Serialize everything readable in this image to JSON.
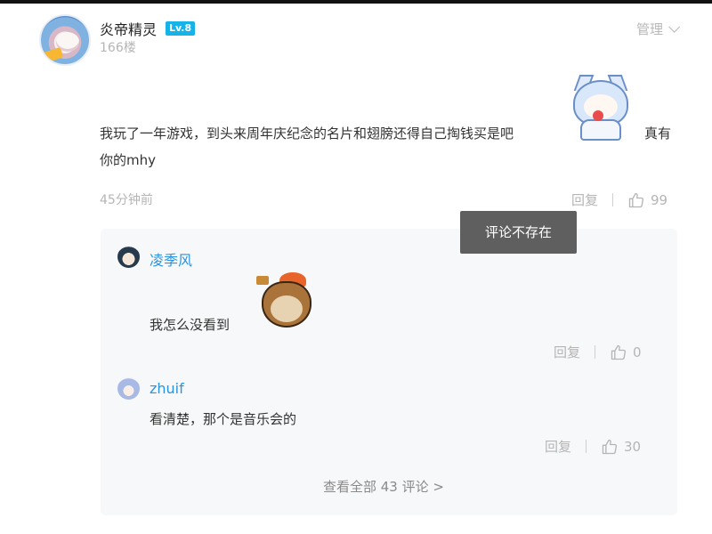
{
  "post": {
    "username": "炎帝精灵",
    "level": "Lv.8",
    "floor": "166楼",
    "manage_label": "管理",
    "content_line1": "我玩了一年游戏，到头来周年庆纪念的名片和翅膀还得自己掏钱买是吧",
    "content_tail": "真有",
    "content_line2": "你的mhy",
    "time": "45分钟前",
    "reply_label": "回复",
    "like_count": "99"
  },
  "replies": [
    {
      "name": "凌季风",
      "text": "我怎么没看到",
      "reply_label": "回复",
      "like_count": "0"
    },
    {
      "name": "zhuif",
      "text": "看清楚，那个是音乐会的",
      "reply_label": "回复",
      "like_count": "30"
    }
  ],
  "view_all_label": "查看全部 43 评论 >",
  "tooltip": "评论不存在",
  "icons": {
    "manage_chevron": "chevron-down-icon",
    "like": "thumbs-up-icon"
  }
}
